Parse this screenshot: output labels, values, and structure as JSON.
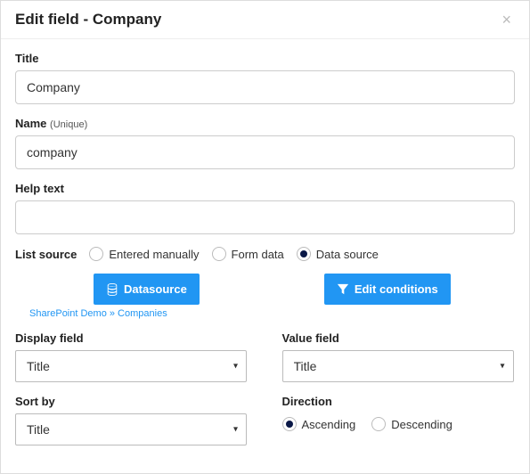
{
  "header": {
    "title": "Edit field - Company"
  },
  "fields": {
    "title": {
      "label": "Title",
      "value": "Company"
    },
    "name": {
      "label": "Name",
      "hint": "(Unique)",
      "value": "company"
    },
    "help": {
      "label": "Help text",
      "value": ""
    }
  },
  "listSource": {
    "label": "List source",
    "options": {
      "manual": "Entered manually",
      "form": "Form data",
      "data": "Data source"
    }
  },
  "buttons": {
    "datasource": "Datasource",
    "editConditions": "Edit conditions"
  },
  "sourcePath": "SharePoint Demo » Companies",
  "displayField": {
    "label": "Display field",
    "value": "Title"
  },
  "valueField": {
    "label": "Value field",
    "value": "Title"
  },
  "sortBy": {
    "label": "Sort by",
    "value": "Title"
  },
  "direction": {
    "label": "Direction",
    "asc": "Ascending",
    "desc": "Descending"
  }
}
